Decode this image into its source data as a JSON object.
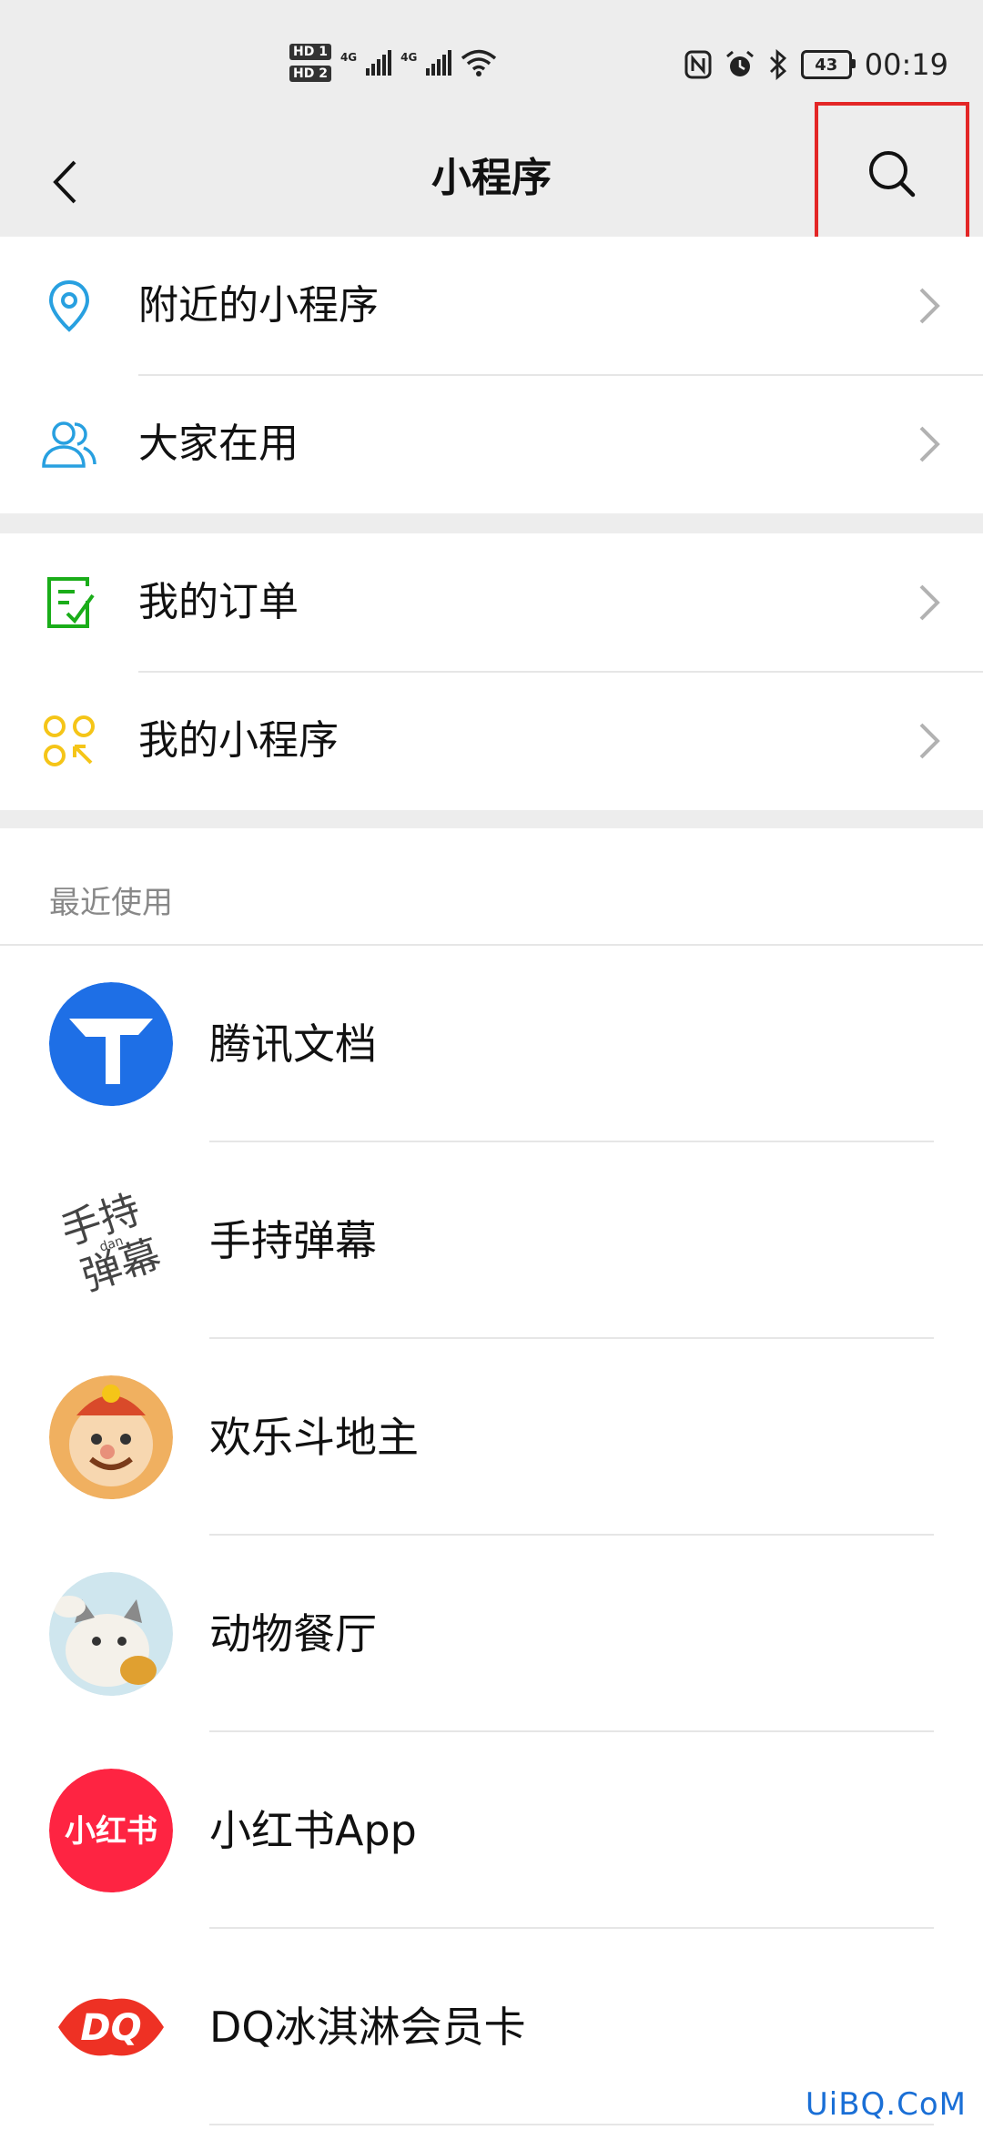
{
  "status_bar": {
    "hd1": "HD 1",
    "hd2": "HD 2",
    "net1": "4G",
    "net2": "4G",
    "battery": "43",
    "time": "00:19"
  },
  "nav": {
    "title": "小程序",
    "back_icon": "chevron-left-icon",
    "search_icon": "search-icon",
    "highlight_color": "#e32626"
  },
  "menu_group_1": [
    {
      "label": "附近的小程序",
      "icon": "location-pin-icon",
      "color": "#28a0e0"
    },
    {
      "label": "大家在用",
      "icon": "people-icon",
      "color": "#28a0e0"
    }
  ],
  "menu_group_2": [
    {
      "label": "我的订单",
      "icon": "order-checklist-icon",
      "color": "#1aad19"
    },
    {
      "label": "我的小程序",
      "icon": "my-miniprogram-icon",
      "color": "#f5c518"
    }
  ],
  "recent": {
    "title": "最近使用",
    "apps": [
      {
        "name": "腾讯文档",
        "icon": "tencent-docs-logo"
      },
      {
        "name": "手持弹幕",
        "icon": "handheld-danmaku-logo",
        "logo_text": "手持 dan 弹幕"
      },
      {
        "name": "欢乐斗地主",
        "icon": "happy-landlord-logo"
      },
      {
        "name": "动物餐厅",
        "icon": "animal-restaurant-logo"
      },
      {
        "name": "小红书App",
        "icon": "xiaohongshu-logo",
        "logo_text": "小红书"
      },
      {
        "name": "DQ冰淇淋会员卡",
        "icon": "dq-logo",
        "logo_text": "DQ"
      }
    ]
  },
  "watermark": "UiBQ.CoM"
}
